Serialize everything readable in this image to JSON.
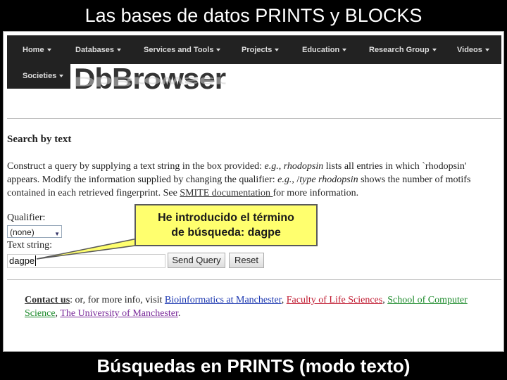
{
  "slide": {
    "title": "Las bases de datos PRINTS y BLOCKS",
    "footer": "Búsquedas en PRINTS (modo texto)"
  },
  "nav": {
    "items": [
      "Home",
      "Databases",
      "Services and Tools",
      "Projects",
      "Education",
      "Research Group",
      "Videos"
    ],
    "societies": "Societies"
  },
  "logo": {
    "text": "DbBrowser"
  },
  "search": {
    "heading": "Search by text",
    "para_1": "Construct a query by supplying a text string in the box provided: ",
    "eg_1": "e.g.",
    "para_2": ", ",
    "rhodopsin_1": "rhodopsin",
    "para_3": " lists all entries in which `rhodopsin' appears. Modify the information supplied by changing the qualifier: ",
    "eg_2": "e.g.",
    "para_4": ", /",
    "type_rhodopsin": "type rhodopsin",
    "para_5": " shows the number of motifs contained in each retrieved fingerprint. See ",
    "smite_link": "SMITE documentation ",
    "para_6": "for more information.",
    "qualifier_label": "Qualifier:",
    "qualifier_value": "(none)",
    "text_label": "Text string:",
    "text_value": "dagpe",
    "send_label": "Send Query",
    "reset_label": "Reset"
  },
  "footer": {
    "contact": "Contact us",
    "text_1": ": or, for more info, visit ",
    "link_bioinf": "Bioinformatics at Manchester",
    "sep_1": ", ",
    "link_fls": "Faculty of Life Sciences",
    "sep_2": ", ",
    "link_scs": "School of Computer Science",
    "sep_3": ", ",
    "link_uom": "The University of Manchester",
    "end": "."
  },
  "callout": {
    "line_1": "He introducido el término",
    "line_2": "de búsqueda: dagpe"
  }
}
